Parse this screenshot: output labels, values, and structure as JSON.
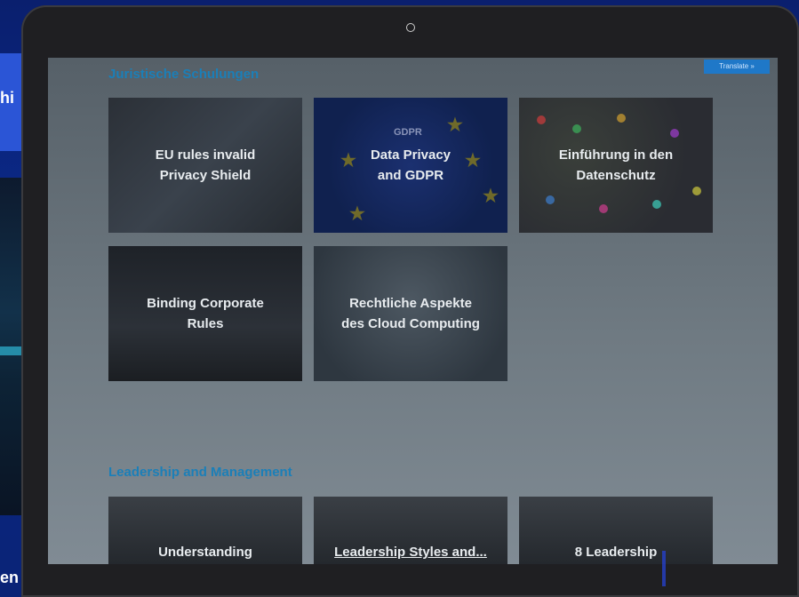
{
  "background": {
    "left_fragment_top": "hi",
    "left_fragment_bottom": "en"
  },
  "translate_label": "Translate »",
  "sections": [
    {
      "title": "Juristische Schulungen",
      "cards": [
        {
          "label": "EU rules invalid\nPrivacy Shield"
        },
        {
          "label": "Data Privacy\nand GDPR",
          "overlay": "GDPR"
        },
        {
          "label": "Einführung in den\nDatenschutz"
        },
        {
          "label": "Binding Corporate\nRules"
        },
        {
          "label": "Rechtliche Aspekte\ndes Cloud Computing"
        }
      ]
    },
    {
      "title": "Leadership and Management",
      "cards": [
        {
          "label": "Understanding"
        },
        {
          "label": "Leadership Styles and..."
        },
        {
          "label": "8 Leadership"
        }
      ]
    }
  ],
  "colors": {
    "accent": "#1b7fb8",
    "frame": "#1f1f22",
    "page_bg": "#0b2a8a"
  }
}
